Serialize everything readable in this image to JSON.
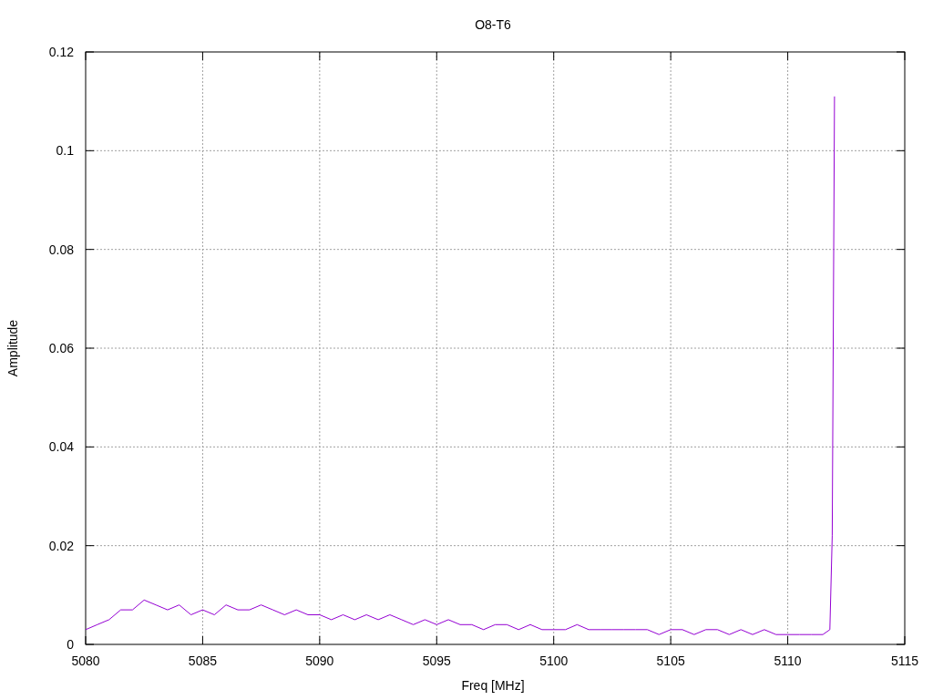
{
  "chart_data": {
    "type": "line",
    "title": "O8-T6",
    "xlabel": "Freq [MHz]",
    "ylabel": "Amplitude",
    "x": [
      5080,
      5080.5,
      5081,
      5081.5,
      5082,
      5082.5,
      5083,
      5083.5,
      5084,
      5084.5,
      5085,
      5085.5,
      5086,
      5086.5,
      5087,
      5087.5,
      5088,
      5088.5,
      5089,
      5089.5,
      5090,
      5090.5,
      5091,
      5091.5,
      5092,
      5092.5,
      5093,
      5093.5,
      5094,
      5094.5,
      5095,
      5095.5,
      5096,
      5096.5,
      5097,
      5097.5,
      5098,
      5098.5,
      5099,
      5099.5,
      5100,
      5100.5,
      5101,
      5101.5,
      5102,
      5102.5,
      5103,
      5103.5,
      5104,
      5104.5,
      5105,
      5105.5,
      5106,
      5106.5,
      5107,
      5107.5,
      5108,
      5108.5,
      5109,
      5109.5,
      5110,
      5110.5,
      5111,
      5111.5,
      5111.8,
      5111.9,
      5112
    ],
    "series": [
      {
        "color": "#9400d3",
        "values": [
          0.003,
          0.004,
          0.005,
          0.007,
          0.007,
          0.009,
          0.008,
          0.007,
          0.008,
          0.006,
          0.007,
          0.006,
          0.008,
          0.007,
          0.007,
          0.008,
          0.007,
          0.006,
          0.007,
          0.006,
          0.006,
          0.005,
          0.006,
          0.005,
          0.006,
          0.005,
          0.006,
          0.005,
          0.004,
          0.005,
          0.004,
          0.005,
          0.004,
          0.004,
          0.003,
          0.004,
          0.004,
          0.003,
          0.004,
          0.003,
          0.003,
          0.003,
          0.004,
          0.003,
          0.003,
          0.003,
          0.003,
          0.003,
          0.003,
          0.002,
          0.003,
          0.003,
          0.002,
          0.003,
          0.003,
          0.002,
          0.003,
          0.002,
          0.003,
          0.002,
          0.002,
          0.002,
          0.002,
          0.002,
          0.003,
          0.022,
          0.111
        ]
      }
    ],
    "grid": true,
    "xlim": [
      5080,
      5115
    ],
    "ylim": [
      0,
      0.12
    ],
    "xticks": [
      5080,
      5085,
      5090,
      5095,
      5100,
      5105,
      5110,
      5115
    ],
    "yticks": [
      {
        "value": 0,
        "label": "0"
      },
      {
        "value": 0.02,
        "label": "0.02"
      },
      {
        "value": 0.04,
        "label": "0.04"
      },
      {
        "value": 0.06,
        "label": "0.06"
      },
      {
        "value": 0.08,
        "label": "0.08"
      },
      {
        "value": 0.1,
        "label": "0.1"
      },
      {
        "value": 0.12,
        "label": "0.12"
      }
    ]
  }
}
